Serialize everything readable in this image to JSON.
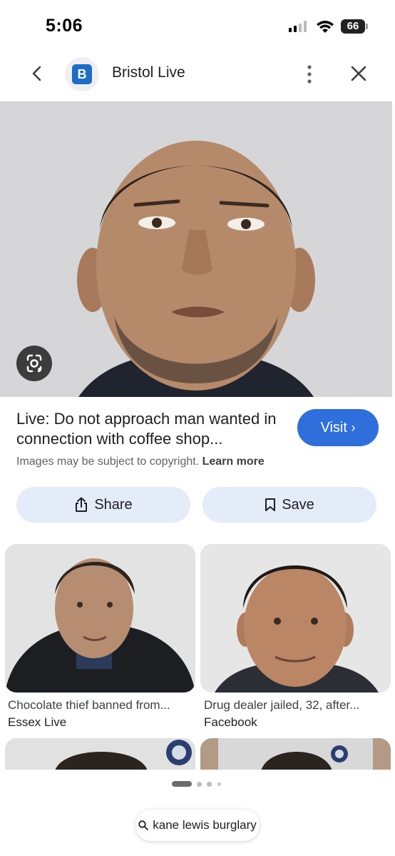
{
  "status_bar": {
    "time": "5:06",
    "battery": "66"
  },
  "header": {
    "favicon_letter": "B",
    "source_name": "Bristol Live"
  },
  "main": {
    "title": "Live: Do not approach man wanted in connection with coffee shop...",
    "visit_label": "Visit",
    "copyright_text": "Images may be subject to copyright.",
    "learn_more": "Learn more",
    "share_label": "Share",
    "save_label": "Save"
  },
  "related": [
    {
      "caption": "Chocolate thief banned from...",
      "source": "Essex Live"
    },
    {
      "caption": "Drug dealer jailed, 32, after...",
      "source": "Facebook"
    }
  ],
  "search_query": "kane lewis burglary",
  "colors": {
    "accent": "#2f6fdc",
    "button_bg": "#e4ecf9",
    "favicon": "#1e6cc4"
  }
}
